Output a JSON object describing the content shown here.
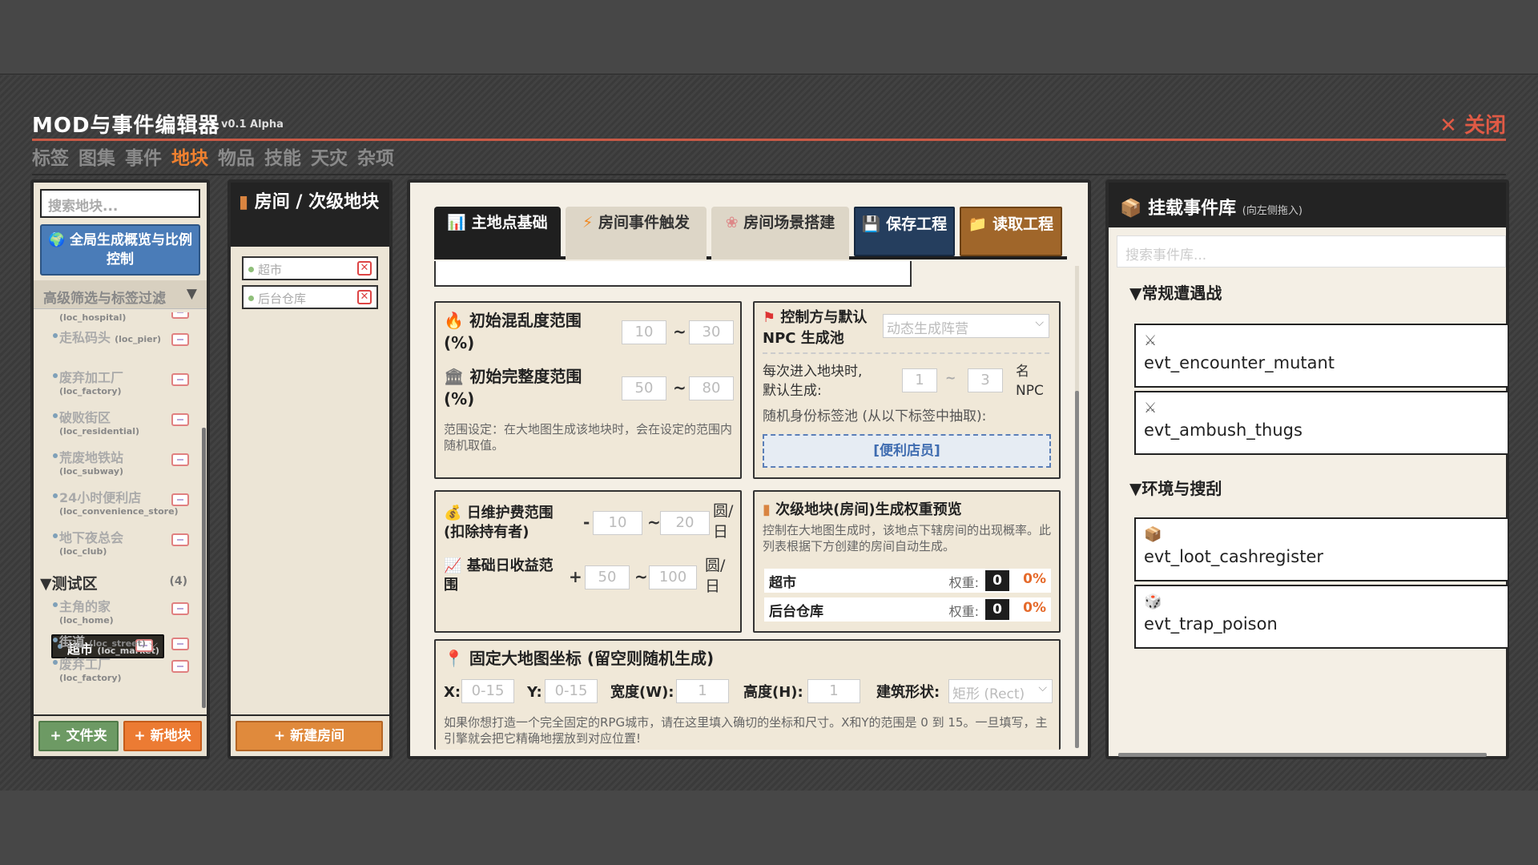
{
  "app": {
    "title": "MOD与事件编辑器",
    "version": "v0.1 Alpha",
    "close_label": "✕ 关闭"
  },
  "nav": [
    "标签",
    "图集",
    "事件",
    "地块",
    "物品",
    "技能",
    "天灾",
    "杂项"
  ],
  "nav_active": "地块",
  "left": {
    "search_placeholder": "搜索地块...",
    "overview_button": "全局生成概览与比例控制",
    "filter_label": "高级筛选与标签过滤",
    "items_top": [
      {
        "name": "",
        "id": "(loc_hospital)"
      },
      {
        "name": "走私码头",
        "id": "(loc_pier)"
      },
      {
        "name": "废弃加工厂",
        "id": "(loc_factory)"
      },
      {
        "name": "破败街区",
        "id": "(loc_residential)"
      },
      {
        "name": "荒废地铁站",
        "id": "(loc_subway)"
      },
      {
        "name": "24小时便利店",
        "id": "(loc_convenience_store)"
      },
      {
        "name": "地下夜总会",
        "id": "(loc_club)"
      }
    ],
    "group": {
      "label": "▼测试区",
      "count": "(4)"
    },
    "items_group": [
      {
        "name": "主角的家",
        "id": "(loc_home)",
        "selected": false
      },
      {
        "name": "超市",
        "id": "(loc_market)",
        "selected": true
      },
      {
        "name": "街道",
        "id": "(loc_street)",
        "selected": false
      },
      {
        "name": "废弃工厂",
        "id": "(loc_factory)",
        "selected": false
      }
    ],
    "add_folder": "+ 文件夹",
    "add_location": "+ 新地块"
  },
  "rooms": {
    "title": "房间 / 次级地块",
    "items": [
      "超市",
      "后台仓库"
    ],
    "add_room": "+ 新建房间"
  },
  "main": {
    "tabs": [
      "主地点基础",
      "房间事件触发",
      "房间场景搭建"
    ],
    "save_label": "保存工程",
    "load_label": "读取工程",
    "chaos": {
      "label": "初始混乱度范围",
      "unit": "(%)",
      "min": "10",
      "max": "30"
    },
    "integrity": {
      "label": "初始完整度范围",
      "unit": "(%)",
      "min": "50",
      "max": "80"
    },
    "range_note": "范围设定：在大地图生成该地块时，会在设定的范围内随机取值。",
    "faction": {
      "label": "控制方与默认",
      "label2": "NPC 生成池",
      "select": "动态生成阵营"
    },
    "npc_spawn": {
      "text": "每次进入地块时,",
      "text2": "默认生成:",
      "min": "1",
      "max": "3",
      "unit": "名",
      "unit2": "NPC"
    },
    "tag_pool_label": "随机身份标签池 (从以下标签中抽取):",
    "tag_pool_value": "[便利店员]",
    "upkeep": {
      "label": "日维护费范围",
      "label2": "(扣除持有者)",
      "sign": "-",
      "min": "10",
      "max": "20",
      "unit": "圆/",
      "unit2": "日"
    },
    "income": {
      "label": "基础日收益范",
      "label2": "围",
      "sign": "+",
      "min": "50",
      "max": "100",
      "unit": "圆/",
      "unit2": "日"
    },
    "weights": {
      "title": "次级地块(房间)生成权重预览",
      "note": "控制在大地图生成时，该地点下辖房间的出现概率。此列表根据下方创建的房间自动生成。",
      "weight_label": "权重:",
      "rows": [
        {
          "name": "超市",
          "value": "0",
          "pct": "0%"
        },
        {
          "name": "后台仓库",
          "value": "0",
          "pct": "0%"
        }
      ]
    },
    "coords": {
      "title": "固定大地图坐标 (留空则随机生成)",
      "x_label": "X:",
      "x_ph": "0-15",
      "y_label": "Y:",
      "y_ph": "0-15",
      "w_label": "宽度(W):",
      "w_val": "1",
      "h_label": "高度(H):",
      "h_val": "1",
      "shape_label": "建筑形状:",
      "shape_val": "矩形 (Rect)",
      "note": "如果你想打造一个完全固定的RPG城市，请在这里填入确切的坐标和尺寸。X和Y的范围是 0 到 15。一旦填写，主引擎就会把它精确地摆放到对应位置!"
    }
  },
  "events": {
    "title": "挂载事件库",
    "hint": "(向左侧拖入)",
    "search_placeholder": "搜索事件库...",
    "categories": [
      {
        "label": "▼常规遭遇战",
        "items": [
          {
            "icon": "⚔",
            "name": "evt_encounter_mutant"
          },
          {
            "icon": "⚔",
            "name": "evt_ambush_thugs"
          }
        ]
      },
      {
        "label": "▼环境与搜刮",
        "items": [
          {
            "icon": "📦",
            "name": "evt_loot_cashregister"
          },
          {
            "icon": "🎲",
            "name": "evt_trap_poison"
          }
        ]
      }
    ]
  },
  "colors": {
    "accent": "#f0812f",
    "close": "#e05a45",
    "blue": "#4a7cb8",
    "green": "#6d9a64"
  }
}
